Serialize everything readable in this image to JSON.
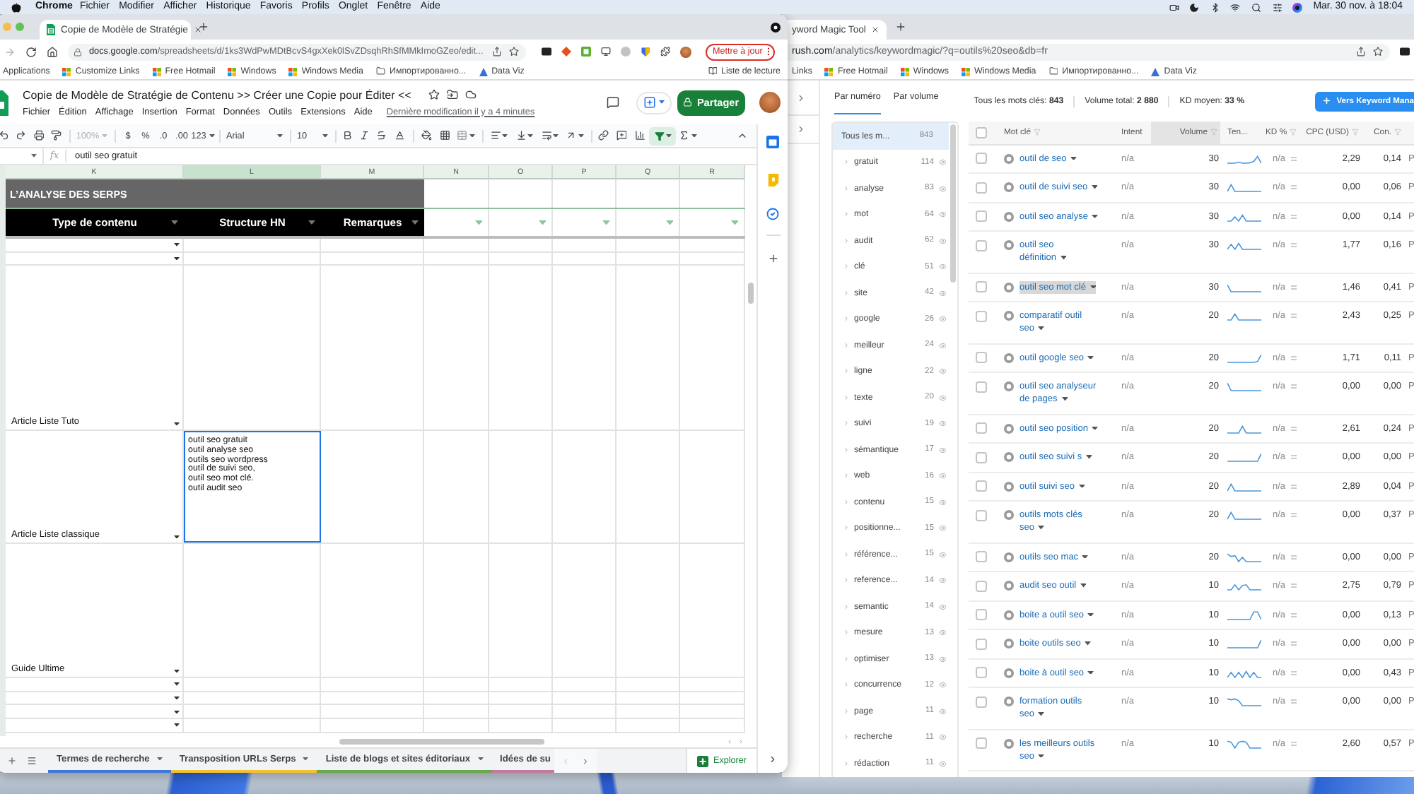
{
  "menu_bar": {
    "app": "Chrome",
    "menus": [
      "Fichier",
      "Modifier",
      "Afficher",
      "Historique",
      "Favoris",
      "Profils",
      "Onglet",
      "Fenêtre",
      "Aide"
    ],
    "clock": "Mar. 30 nov. à 18:04"
  },
  "sheets_window": {
    "tab": {
      "title": "Copie de Modèle de Stratégie"
    },
    "address": {
      "host": "docs.google.com",
      "path": "/spreadsheets/d/1ks3WdPwMDtBcvS4gxXek0lSvZDsqhRhSfMMkImoGZeo/edit..."
    },
    "update_button": "Mettre à jour",
    "bookmarks": [
      {
        "label": "Applications",
        "kind": "text"
      },
      {
        "label": "Customize Links",
        "kind": "windows"
      },
      {
        "label": "Free Hotmail",
        "kind": "windows"
      },
      {
        "label": "Windows",
        "kind": "windows"
      },
      {
        "label": "Windows Media",
        "kind": "windows"
      },
      {
        "label": "Импортированно...",
        "kind": "folder"
      },
      {
        "label": "Data Viz",
        "kind": "chart"
      }
    ],
    "reading_list": "Liste de lecture",
    "doc": {
      "title": "Copie de Modèle de Stratégie de Contenu >> Créer une Copie pour Éditer <<",
      "menus": [
        "Fichier",
        "Édition",
        "Affichage",
        "Insertion",
        "Format",
        "Données",
        "Outils",
        "Extensions",
        "Aide"
      ],
      "last_edit": "Dernière modification il y a 4 minutes",
      "share_button": "Partager"
    },
    "toolbar": {
      "zoom": {
        "label": "100%",
        "disabled": true
      },
      "number_formats": [
        "$",
        "%",
        ".0",
        ".00"
      ],
      "more_formats": "123",
      "font": "Arial",
      "font_size": "10"
    },
    "formula_bar": {
      "label": "fx",
      "value": "outil seo gratuit"
    },
    "columns": [
      {
        "label": "K",
        "selected": false
      },
      {
        "label": "L",
        "selected": true
      },
      {
        "label": "M",
        "selected": false
      },
      {
        "label": "N",
        "selected": false
      },
      {
        "label": "O",
        "selected": false
      },
      {
        "label": "P",
        "selected": false
      },
      {
        "label": "Q",
        "selected": false
      },
      {
        "label": "R",
        "selected": false
      }
    ],
    "section_title": "L’ANALYSE DES SERPS",
    "header_cells": [
      "Type de contenu",
      "Structure HN",
      "Remarques"
    ],
    "rows": [
      {
        "kind": "small",
        "structure_cell": {
          "selected": false
        }
      },
      {
        "kind": "small",
        "structure_cell": {
          "selected": false
        }
      },
      {
        "kind": "tall",
        "type": "Article Liste Tuto",
        "structure_cell": {
          "selected": false
        }
      },
      {
        "kind": "tall",
        "type": "Article Liste classique",
        "structure_cell": {
          "selected": true,
          "value": "outil seo gratuit\noutil analyse seo\noutils seo wordpress\noutil de suivi seo,\noutil seo mot clé.\noutil audit seo"
        }
      },
      {
        "kind": "tall",
        "type": "Guide Ultime",
        "structure_cell": {
          "selected": false
        }
      },
      {
        "kind": "small",
        "structure_cell": {
          "selected": false
        }
      },
      {
        "kind": "small",
        "structure_cell": {
          "selected": false
        }
      },
      {
        "kind": "small",
        "structure_cell": {
          "selected": false
        }
      },
      {
        "kind": "small",
        "structure_cell": {
          "selected": false
        }
      }
    ],
    "sheet_tabs": [
      {
        "label": "Termes de recherche",
        "color": "#3d78d8"
      },
      {
        "label": "Transposition URLs Serps",
        "color": "#f1c232"
      },
      {
        "label": "Liste de blogs et sites éditoriaux",
        "color": "#6aa84f"
      },
      {
        "label": "Idées de su",
        "color": "#c27ba0"
      }
    ],
    "explore_button": "Explorer"
  },
  "semrush_window": {
    "tab": {
      "title": "yword Magic Tool"
    },
    "address": {
      "host": "rush.com",
      "path": "/analytics/keywordmagic/?q=outils%20seo&db=fr"
    },
    "bookmarks": [
      {
        "label": "Links",
        "kind": "text"
      },
      {
        "label": "Free Hotmail",
        "kind": "windows"
      },
      {
        "label": "Windows",
        "kind": "windows"
      },
      {
        "label": "Windows Media",
        "kind": "windows"
      },
      {
        "label": "Импортированно...",
        "kind": "folder"
      },
      {
        "label": "Data Viz",
        "kind": "chart"
      }
    ],
    "view_tabs": [
      {
        "label": "Par numéro",
        "selected": true
      },
      {
        "label": "Par volume",
        "selected": false
      }
    ],
    "stats": [
      "Tous les mots clés: **843**",
      "Volume total: **2 880**",
      "KD moyen: **33 %**"
    ],
    "action_button": "Vers Keyword Mana",
    "groups": [
      {
        "label": "Tous les m...",
        "count": "843",
        "kind": "all",
        "selected": true
      },
      {
        "label": "gratuit",
        "count": "114",
        "kind": "group",
        "selected": false
      },
      {
        "label": "analyse",
        "count": "83",
        "kind": "group",
        "selected": false
      },
      {
        "label": "mot",
        "count": "64",
        "kind": "group",
        "selected": false
      },
      {
        "label": "audit",
        "count": "62",
        "kind": "group",
        "selected": false
      },
      {
        "label": "clé",
        "count": "51",
        "kind": "group",
        "selected": false
      },
      {
        "label": "site",
        "count": "42",
        "kind": "group",
        "selected": false
      },
      {
        "label": "google",
        "count": "26",
        "kind": "group",
        "selected": false
      },
      {
        "label": "meilleur",
        "count": "24",
        "kind": "group",
        "selected": false
      },
      {
        "label": "ligne",
        "count": "22",
        "kind": "group",
        "selected": false
      },
      {
        "label": "texte",
        "count": "20",
        "kind": "group",
        "selected": false
      },
      {
        "label": "suivi",
        "count": "19",
        "kind": "group",
        "selected": false
      },
      {
        "label": "sémantique",
        "count": "17",
        "kind": "group",
        "selected": false
      },
      {
        "label": "web",
        "count": "16",
        "kind": "group",
        "selected": false
      },
      {
        "label": "contenu",
        "count": "15",
        "kind": "group",
        "selected": false
      },
      {
        "label": "positionne...",
        "count": "15",
        "kind": "group",
        "selected": false
      },
      {
        "label": "référence...",
        "count": "15",
        "kind": "group",
        "selected": false
      },
      {
        "label": "reference...",
        "count": "14",
        "kind": "group",
        "selected": false
      },
      {
        "label": "semantic",
        "count": "14",
        "kind": "group",
        "selected": false
      },
      {
        "label": "mesure",
        "count": "13",
        "kind": "group",
        "selected": false
      },
      {
        "label": "optimiser",
        "count": "13",
        "kind": "group",
        "selected": false
      },
      {
        "label": "concurrence",
        "count": "12",
        "kind": "group",
        "selected": false
      },
      {
        "label": "page",
        "count": "11",
        "kind": "group",
        "selected": false
      },
      {
        "label": "recherche",
        "count": "11",
        "kind": "group",
        "selected": false
      },
      {
        "label": "rédaction",
        "count": "11",
        "kind": "group",
        "selected": false
      }
    ],
    "table": {
      "select_all_checked": false,
      "columns": [
        {
          "label": "Mot clé",
          "kind": "text",
          "filter": true,
          "sorted": false
        },
        {
          "label": "Intent",
          "kind": "text",
          "filter": false,
          "sorted": false
        },
        {
          "label": "Volume",
          "kind": "number",
          "filter": true,
          "sorted": true
        },
        {
          "label": "Ten...",
          "kind": "text",
          "filter": false,
          "sorted": false
        },
        {
          "label": "KD %",
          "kind": "text",
          "filter": true,
          "sorted": false
        },
        {
          "label": "CPC (USD)",
          "kind": "number",
          "filter": true,
          "sorted": false
        },
        {
          "label": "Con.",
          "kind": "number",
          "filter": true,
          "sorted": false
        }
      ],
      "rows": [
        {
          "keyword": "outil de seo",
          "intent": "n/a",
          "volume": "30",
          "kd": "n/a",
          "cpc": "2,29",
          "com": "0,14",
          "column_9": "P",
          "checked": false,
          "highlighted": false
        },
        {
          "keyword": "outil de suivi seo",
          "intent": "n/a",
          "volume": "30",
          "kd": "n/a",
          "cpc": "0,00",
          "com": "0,06",
          "column_9": "P",
          "checked": false,
          "highlighted": false
        },
        {
          "keyword": "outil seo analyse",
          "intent": "n/a",
          "volume": "30",
          "kd": "n/a",
          "cpc": "0,00",
          "com": "0,14",
          "column_9": "P",
          "checked": false,
          "highlighted": false
        },
        {
          "keyword": "outil seo définition",
          "intent": "n/a",
          "volume": "30",
          "kd": "n/a",
          "cpc": "1,77",
          "com": "0,16",
          "column_9": "P",
          "checked": false,
          "highlighted": false
        },
        {
          "keyword": "outil seo mot clé",
          "intent": "n/a",
          "volume": "30",
          "kd": "n/a",
          "cpc": "1,46",
          "com": "0,41",
          "column_9": "P",
          "checked": false,
          "highlighted": true
        },
        {
          "keyword": "comparatif outil seo",
          "intent": "n/a",
          "volume": "20",
          "kd": "n/a",
          "cpc": "2,43",
          "com": "0,25",
          "column_9": "P",
          "checked": false,
          "highlighted": false
        },
        {
          "keyword": "outil google seo",
          "intent": "n/a",
          "volume": "20",
          "kd": "n/a",
          "cpc": "1,71",
          "com": "0,11",
          "column_9": "P",
          "checked": false,
          "highlighted": false
        },
        {
          "keyword": "outil seo analyseur de pages",
          "intent": "n/a",
          "volume": "20",
          "kd": "n/a",
          "cpc": "0,00",
          "com": "0,00",
          "column_9": "P",
          "checked": false,
          "highlighted": false
        },
        {
          "keyword": "outil seo position",
          "intent": "n/a",
          "volume": "20",
          "kd": "n/a",
          "cpc": "2,61",
          "com": "0,24",
          "column_9": "P",
          "checked": false,
          "highlighted": false
        },
        {
          "keyword": "outil seo suivi s",
          "intent": "n/a",
          "volume": "20",
          "kd": "n/a",
          "cpc": "0,00",
          "com": "0,00",
          "column_9": "P",
          "checked": false,
          "highlighted": false
        },
        {
          "keyword": "outil suivi seo",
          "intent": "n/a",
          "volume": "20",
          "kd": "n/a",
          "cpc": "2,89",
          "com": "0,04",
          "column_9": "P",
          "checked": false,
          "highlighted": false
        },
        {
          "keyword": "outils mots clés seo",
          "intent": "n/a",
          "volume": "20",
          "kd": "n/a",
          "cpc": "0,00",
          "com": "0,37",
          "column_9": "P",
          "checked": false,
          "highlighted": false
        },
        {
          "keyword": "outils seo mac",
          "intent": "n/a",
          "volume": "20",
          "kd": "n/a",
          "cpc": "0,00",
          "com": "0,00",
          "column_9": "P",
          "checked": false,
          "highlighted": false
        },
        {
          "keyword": "audit seo outil",
          "intent": "n/a",
          "volume": "10",
          "kd": "n/a",
          "cpc": "2,75",
          "com": "0,79",
          "column_9": "P",
          "checked": false,
          "highlighted": false
        },
        {
          "keyword": "boite a outil seo",
          "intent": "n/a",
          "volume": "10",
          "kd": "n/a",
          "cpc": "0,00",
          "com": "0,13",
          "column_9": "P",
          "checked": false,
          "highlighted": false
        },
        {
          "keyword": "boite outils seo",
          "intent": "n/a",
          "volume": "10",
          "kd": "n/a",
          "cpc": "0,00",
          "com": "0,00",
          "column_9": "P",
          "checked": false,
          "highlighted": false
        },
        {
          "keyword": "boite à outil seo",
          "intent": "n/a",
          "volume": "10",
          "kd": "n/a",
          "cpc": "0,00",
          "com": "0,43",
          "column_9": "P",
          "checked": false,
          "highlighted": false
        },
        {
          "keyword": "formation outils seo",
          "intent": "n/a",
          "volume": "10",
          "kd": "n/a",
          "cpc": "0,00",
          "com": "0,00",
          "column_9": "P",
          "checked": false,
          "highlighted": false
        },
        {
          "keyword": "les meilleurs outils seo",
          "intent": "n/a",
          "volume": "10",
          "kd": "n/a",
          "cpc": "2,60",
          "com": "0,57",
          "column_9": "P",
          "checked": false,
          "highlighted": false
        }
      ]
    }
  }
}
